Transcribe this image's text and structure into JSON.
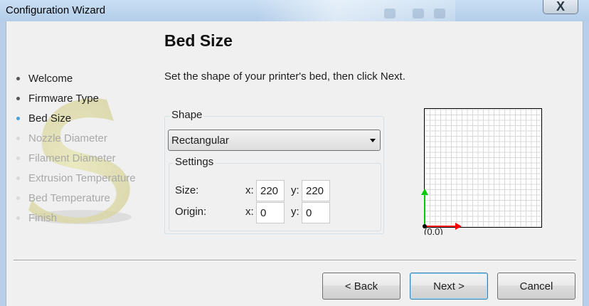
{
  "window": {
    "title": "Configuration Wizard",
    "close_label": "X"
  },
  "sidebar": {
    "steps": [
      {
        "label": "Welcome",
        "state": "done"
      },
      {
        "label": "Firmware Type",
        "state": "done"
      },
      {
        "label": "Bed Size",
        "state": "active"
      },
      {
        "label": "Nozzle Diameter",
        "state": "todo"
      },
      {
        "label": "Filament Diameter",
        "state": "todo"
      },
      {
        "label": "Extrusion Temperature",
        "state": "todo"
      },
      {
        "label": "Bed Temperature",
        "state": "todo"
      },
      {
        "label": "Finish",
        "state": "todo"
      }
    ]
  },
  "page": {
    "title": "Bed Size",
    "instruction": "Set the shape of your printer's bed, then click Next."
  },
  "shape": {
    "legend": "Shape",
    "selected": "Rectangular",
    "settings": {
      "legend": "Settings",
      "size": {
        "label": "Size:",
        "x_label": "x:",
        "x": "220",
        "y_label": "y:",
        "y": "220"
      },
      "origin": {
        "label": "Origin:",
        "x_label": "x:",
        "x": "0",
        "y_label": "y:",
        "y": "0"
      }
    }
  },
  "preview": {
    "origin_label": "(0,0)",
    "x_axis_color": "#ff0000",
    "y_axis_color": "#00cc00"
  },
  "buttons": {
    "back": "< Back",
    "next": "Next >",
    "cancel": "Cancel"
  },
  "colors": {
    "titlebar": "#c0d8f0",
    "active_step": "#4a9fd8",
    "default_button_border": "#3c7fb1"
  }
}
